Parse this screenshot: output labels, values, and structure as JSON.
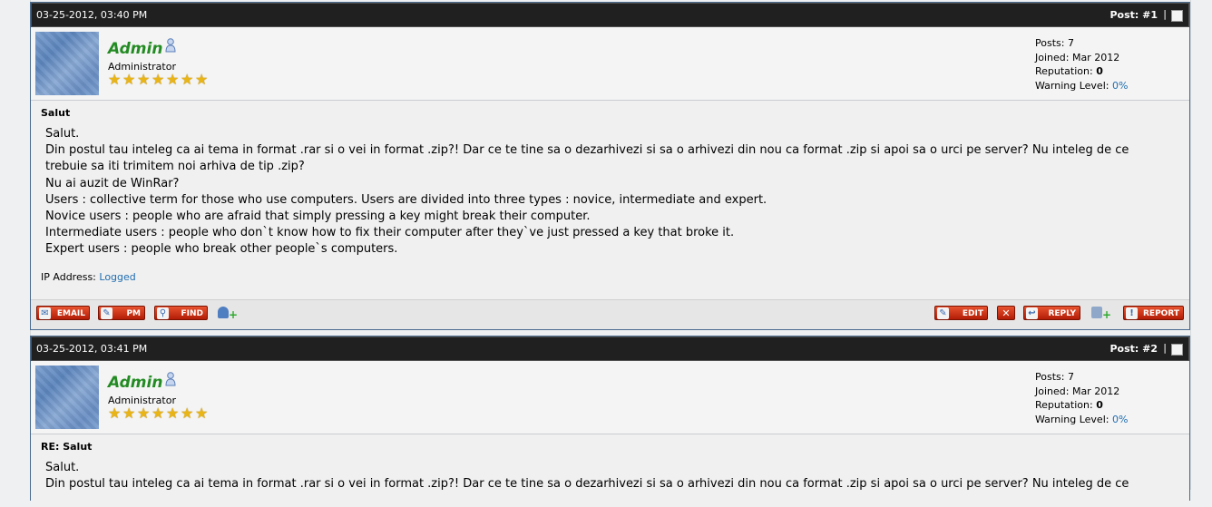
{
  "posts": [
    {
      "date": "03-25-2012, 03:40 PM",
      "number": "Post: #1",
      "separator": "|",
      "user": {
        "name": "Admin",
        "title": "Administrator",
        "stars": 7,
        "posts": "Posts: 7",
        "joined": "Joined: Mar 2012",
        "reputation_label": "Reputation:",
        "reputation_value": "0",
        "warning_label": "Warning Level:",
        "warning_value": "0%"
      },
      "subject": "Salut",
      "lines": [
        "Salut.",
        "Din postul tau inteleg ca ai tema in format .rar si o vei in format .zip?! Dar ce te tine sa o dezarhivezi si sa o arhivezi din nou ca format .zip si apoi sa o urci pe server? Nu inteleg de ce",
        "trebuie sa iti trimitem noi arhiva de tip .zip?",
        "Nu ai auzit de WinRar?",
        "Users : collective term for those who use computers. Users are divided into three types : novice, intermediate and expert.",
        "Novice users : people who are afraid that simply pressing a key might break their computer.",
        "Intermediate users : people who don`t know how to fix their computer after they`ve just pressed a key that broke it.",
        "Expert users : people who break other people`s computers."
      ],
      "ip_label": "IP Address:",
      "ip_value": "Logged",
      "buttons": {
        "email": "EMAIL",
        "pm": "PM",
        "find": "FIND",
        "edit": "EDIT",
        "delete": "✕",
        "reply": "REPLY",
        "report": "REPORT"
      }
    },
    {
      "date": "03-25-2012, 03:41 PM",
      "number": "Post: #2",
      "separator": "|",
      "user": {
        "name": "Admin",
        "title": "Administrator",
        "stars": 7,
        "posts": "Posts: 7",
        "joined": "Joined: Mar 2012",
        "reputation_label": "Reputation:",
        "reputation_value": "0",
        "warning_label": "Warning Level:",
        "warning_value": "0%"
      },
      "subject": "RE: Salut",
      "lines": [
        "Salut.",
        "Din postul tau inteleg ca ai tema in format .rar si o vei in format .zip?! Dar ce te tine sa o dezarhivezi si sa o arhivezi din nou ca format .zip si apoi sa o urci pe server? Nu inteleg de ce"
      ]
    }
  ],
  "colors": {
    "header_bg": "#202020",
    "username": "#238b23",
    "link": "#1f6db0",
    "button_red": "#c8300f"
  }
}
